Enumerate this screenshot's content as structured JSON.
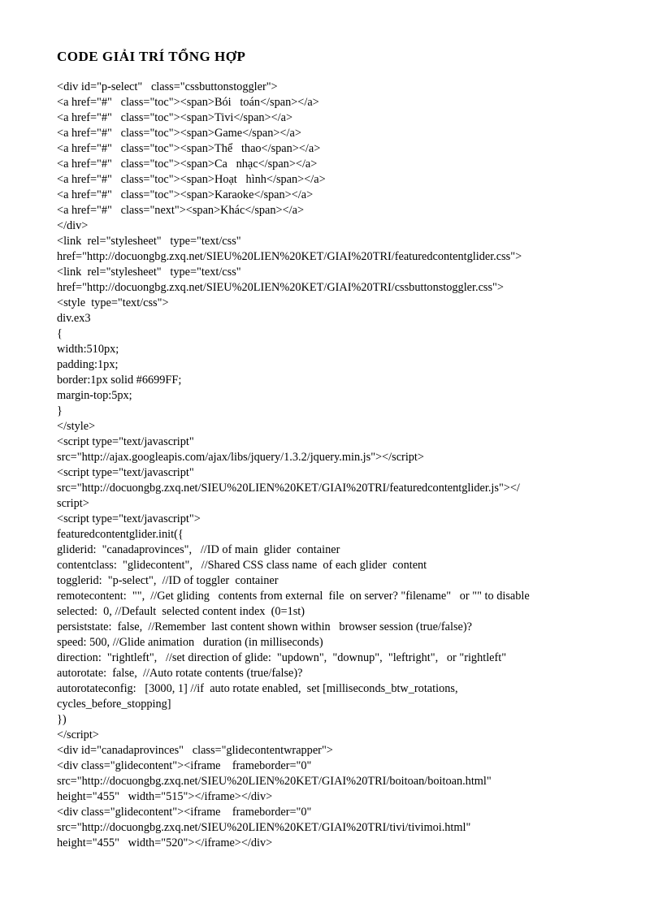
{
  "title": "CODE GIẢI TRÍ TỔNG HỢP",
  "lines": [
    "<div id=\"p-select\"   class=\"cssbuttonstoggler\">",
    "<a href=\"#\"   class=\"toc\"><span>Bói   toán</span></a>",
    "<a href=\"#\"   class=\"toc\"><span>Tivi</span></a>",
    "<a href=\"#\"   class=\"toc\"><span>Game</span></a>",
    "<a href=\"#\"   class=\"toc\"><span>Thể   thao</span></a>",
    "<a href=\"#\"   class=\"toc\"><span>Ca   nhạc</span></a>",
    "<a href=\"#\"   class=\"toc\"><span>Hoạt   hình</span></a>",
    "<a href=\"#\"   class=\"toc\"><span>Karaoke</span></a>",
    "<a href=\"#\"   class=\"next\"><span>Khác</span></a>",
    "</div>",
    "<link  rel=\"stylesheet\"   type=\"text/css\"",
    "href=\"http://docuongbg.zxq.net/SIEU%20LIEN%20KET/GIAI%20TRI/featuredcontentglider.css\">",
    "<link  rel=\"stylesheet\"   type=\"text/css\"",
    "href=\"http://docuongbg.zxq.net/SIEU%20LIEN%20KET/GIAI%20TRI/cssbuttonstoggler.css\">",
    "<style  type=\"text/css\">",
    "div.ex3",
    "{",
    "width:510px;",
    "padding:1px;",
    "border:1px solid #6699FF;",
    "margin-top:5px;",
    "}",
    "</style>",
    "<script type=\"text/javascript\"",
    "src=\"http://ajax.googleapis.com/ajax/libs/jquery/1.3.2/jquery.min.js\"></script>",
    "<script type=\"text/javascript\"",
    "src=\"http://docuongbg.zxq.net/SIEU%20LIEN%20KET/GIAI%20TRI/featuredcontentglider.js\"></",
    "script>",
    "<script type=\"text/javascript\">",
    "featuredcontentglider.init({",
    "gliderid:  \"canadaprovinces\",   //ID of main  glider  container",
    "contentclass:  \"glidecontent\",   //Shared CSS class name  of each glider  content",
    "togglerid:  \"p-select\",  //ID of toggler  container",
    "remotecontent:  \"\",  //Get gliding   contents from external  file  on server? \"filename\"   or \"\" to disable",
    "selected:  0, //Default  selected content index  (0=1st)",
    "persiststate:  false,  //Remember  last content shown within   browser session (true/false)?",
    "speed: 500, //Glide animation   duration (in milliseconds)",
    "direction:  \"rightleft\",   //set direction of glide:  \"updown\",  \"downup\",  \"leftright\",   or \"rightleft\"",
    "autorotate:  false,  //Auto rotate contents (true/false)?",
    "autorotateconfig:   [3000, 1] //if  auto rotate enabled,  set [milliseconds_btw_rotations,",
    "cycles_before_stopping]",
    "})",
    "</script>",
    "<div id=\"canadaprovinces\"   class=\"glidecontentwrapper\">",
    "<div class=\"glidecontent\"><iframe    frameborder=\"0\"",
    "src=\"http://docuongbg.zxq.net/SIEU%20LIEN%20KET/GIAI%20TRI/boitoan/boitoan.html\"",
    "height=\"455\"   width=\"515\"></iframe></div>",
    "<div class=\"glidecontent\"><iframe    frameborder=\"0\"",
    "src=\"http://docuongbg.zxq.net/SIEU%20LIEN%20KET/GIAI%20TRI/tivi/tivimoi.html\"",
    "height=\"455\"   width=\"520\"></iframe></div>"
  ]
}
